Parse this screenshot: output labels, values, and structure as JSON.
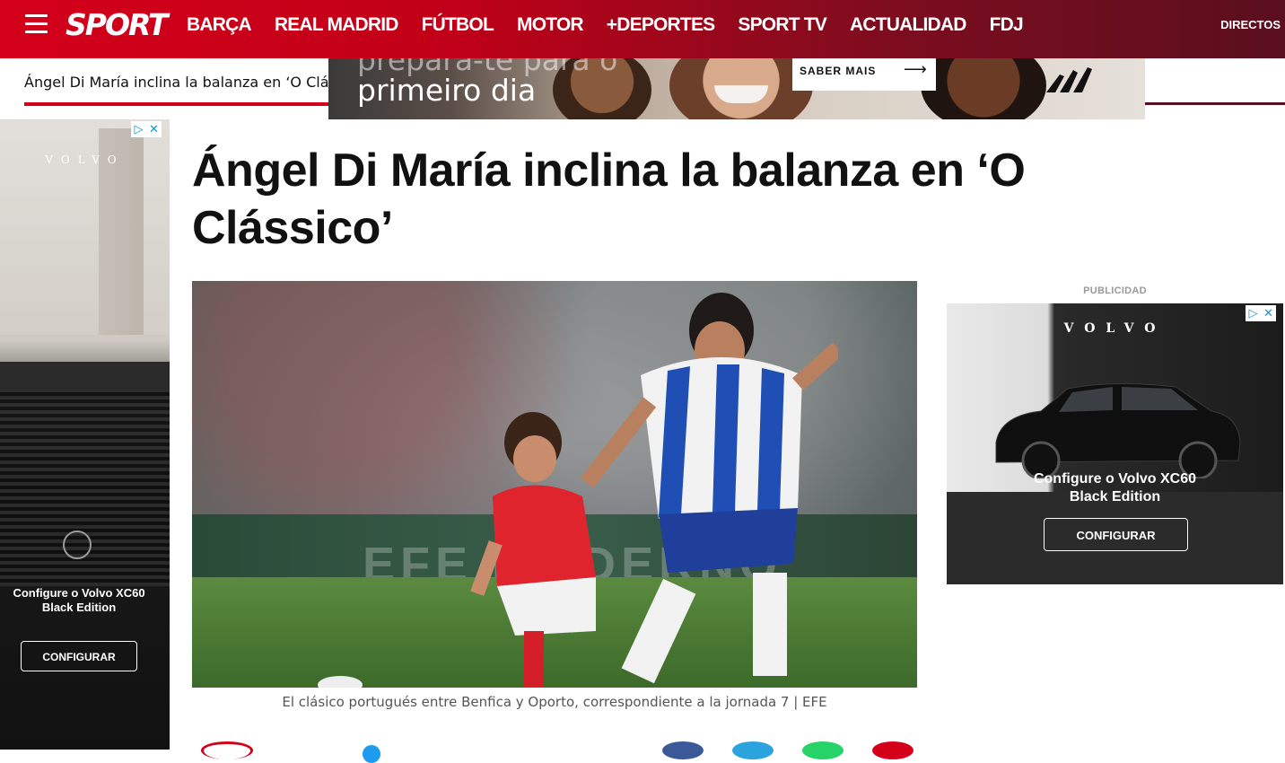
{
  "header": {
    "logo": "SPORT",
    "nav": [
      "BARÇA",
      "REAL MADRID",
      "FÚTBOL",
      "MOTOR",
      "+DEPORTES",
      "SPORT TV",
      "ACTUALIDAD",
      "FDJ"
    ],
    "directos": "DIRECTOS",
    "brand_color": "#d4001a"
  },
  "subbar": {
    "title": "Ángel Di María inclina la balanza en ‘O Clás"
  },
  "top_ad": {
    "headline_top": "prepara-te para o",
    "headline": "primeiro dia",
    "button": "SABER MAIS",
    "icon": "arrow-right-icon"
  },
  "left_ad": {
    "brand": "VOLVO",
    "text_line1": "Configure o Volvo XC60",
    "text_line2": "Black Edition",
    "button": "CONFIGURAR"
  },
  "article": {
    "headline": "Ángel Di María inclina la balanza en ‘O Clássico’",
    "caption": "El clásico portugués entre Benfica y Oporto, correspondiente a la jornada 7 | EFE",
    "hero_board_text": "EFE   MODERNO"
  },
  "right_ad": {
    "label": "PUBLICIDAD",
    "brand": "VOLVO",
    "text_line1": "Configure o Volvo XC60",
    "text_line2": "Black Edition",
    "button": "CONFIGURAR"
  },
  "adchoice": {
    "info": "▷",
    "close": "✕"
  }
}
